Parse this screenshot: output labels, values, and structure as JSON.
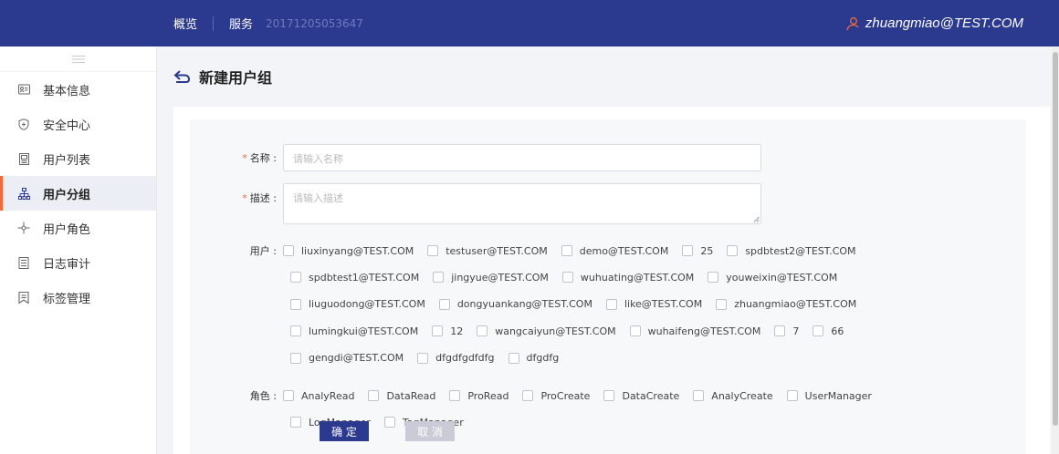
{
  "header": {
    "nav_overview": "概览",
    "nav_service": "服务",
    "service_id": "20171205053647",
    "username": "zhuangmiao@TEST.COM",
    "bg_color": "#2b3a8f"
  },
  "sidebar": {
    "items": [
      {
        "label": "基本信息",
        "icon": "id-card-icon"
      },
      {
        "label": "安全中心",
        "icon": "shield-icon"
      },
      {
        "label": "用户列表",
        "icon": "user-list-icon"
      },
      {
        "label": "用户分组",
        "icon": "hierarchy-icon",
        "active": true
      },
      {
        "label": "用户角色",
        "icon": "role-icon"
      },
      {
        "label": "日志审计",
        "icon": "log-icon"
      },
      {
        "label": "标签管理",
        "icon": "tag-icon"
      }
    ],
    "active_accent": "#f06a3c"
  },
  "page": {
    "title": "新建用户组"
  },
  "form": {
    "name_label": "名称 :",
    "name_placeholder": "请输入名称",
    "desc_label": "描述 :",
    "desc_placeholder": "请输入描述",
    "users_label": "用户 :",
    "users": [
      "liuxinyang@TEST.COM",
      "testuser@TEST.COM",
      "demo@TEST.COM",
      "25",
      "spdbtest2@TEST.COM",
      "spdbtest1@TEST.COM",
      "jingyue@TEST.COM",
      "wuhuating@TEST.COM",
      "youweixin@TEST.COM",
      "liuguodong@TEST.COM",
      "dongyuankang@TEST.COM",
      "like@TEST.COM",
      "zhuangmiao@TEST.COM",
      "lumingkui@TEST.COM",
      "12",
      "wangcaiyun@TEST.COM",
      "wuhaifeng@TEST.COM",
      "7",
      "66",
      "gengdi@TEST.COM",
      "dfgdfgdfdfg",
      "dfgdfg"
    ],
    "roles_label": "角色 :",
    "roles": [
      "AnalyRead",
      "DataRead",
      "ProRead",
      "ProCreate",
      "DataCreate",
      "AnalyCreate",
      "UserManager",
      "LogManager",
      "TagManager"
    ],
    "confirm_label": "确 定",
    "cancel_label": "取 消"
  }
}
